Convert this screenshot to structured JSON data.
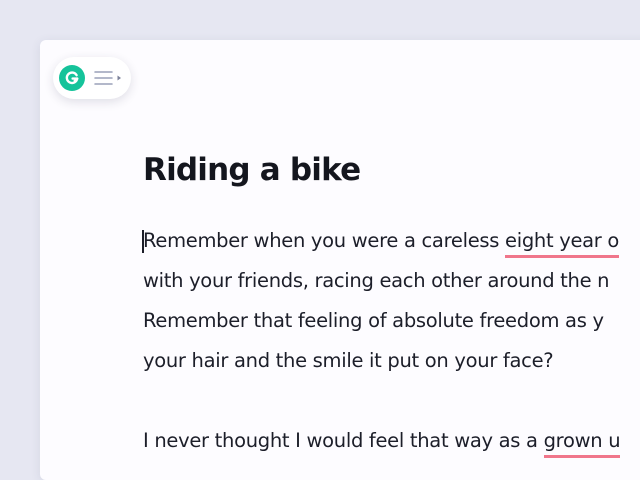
{
  "toolbar": {
    "logo_letter": "G",
    "logo_icon": "grammarly-g-icon",
    "menu_icon": "hamburger-menu-icon",
    "accent_color": "#15c39a"
  },
  "document": {
    "title": "Riding a bike",
    "paragraphs": [
      {
        "lines": [
          {
            "before": "Remember when you were a careless ",
            "flagged": "eight year o",
            "after": ""
          },
          {
            "before": "with your friends, racing each other around the n",
            "flagged": "",
            "after": ""
          },
          {
            "before": "Remember that feeling of absolute freedom as y",
            "flagged": "",
            "after": ""
          },
          {
            "before": "your hair and the smile it put on your face?",
            "flagged": "",
            "after": ""
          }
        ]
      },
      {
        "lines": [
          {
            "before": "I never thought I would feel that way as a ",
            "flagged": "grown u",
            "after": ""
          }
        ]
      }
    ],
    "suggestion_underline_color": "#f0768b"
  }
}
